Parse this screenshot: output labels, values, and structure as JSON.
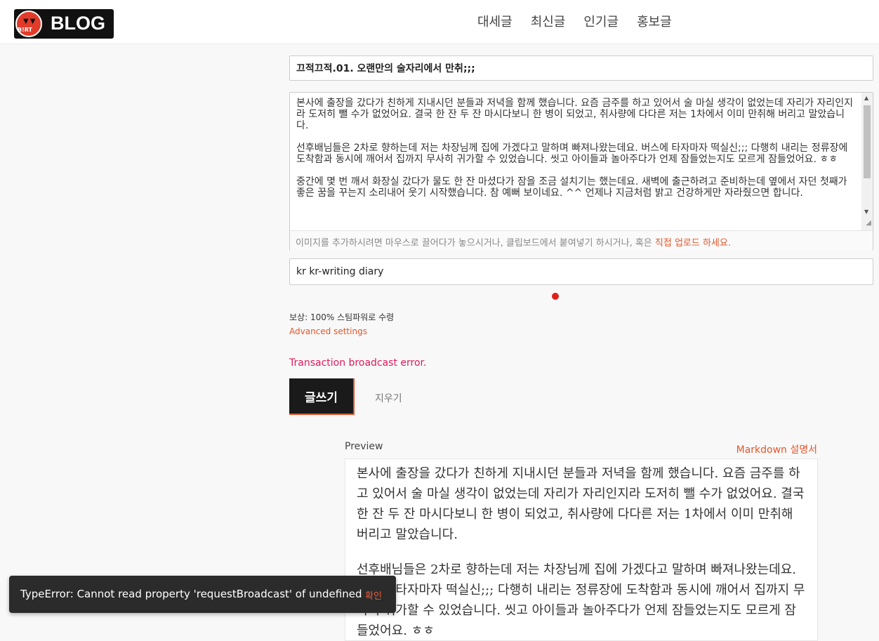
{
  "header": {
    "logo_text": "BLOG",
    "logo_badge_text": "B!RT",
    "nav": [
      "대세글",
      "최신글",
      "인기글",
      "홍보글"
    ]
  },
  "editor": {
    "title_value": "끄적끄적.01. 오랜만의 술자리에서 만취;;;",
    "body_paragraphs": [
      "본사에 출장을 갔다가 친하게 지내시던 분들과 저녁을 함께 했습니다. 요즘 금주를 하고 있어서 술 마실 생각이 없었는데 자리가 자리인지라 도저히 뺄 수가 없었어요. 결국 한 잔 두 잔 마시다보니 한 병이 되었고, 취사량에 다다른 저는 1차에서 이미 만취해 버리고 말았습니다.",
      "선후배님들은 2차로 향하는데 저는 차장님께 집에 가겠다고 말하며 빠져나왔는데요. 버스에 타자마자 떡실신;;; 다행히 내리는 정류장에 도착함과 동시에 깨어서 집까지 무사히 귀가할 수 있었습니다. 씻고 아이들과 놀아주다가 언제 잠들었는지도 모르게 잠들었어요. ㅎㅎ",
      "중간에 몇 번 깨서 화장실 갔다가 물도 한 잔 마셨다가 잠을 조금 설치기는 했는데요. 새벽에 출근하려고 준비하는데 옆에서 자던 첫째가 좋은 꿈을 꾸는지 소리내어 웃기 시작했습니다. 참 예뻐 보이네요. ^^ 언제나 지금처럼 밝고 건강하게만 자라줬으면 합니다."
    ],
    "upload_hint_prefix": "이미지를 추가하시려면 마우스로 끌어다가 놓으시거나, 클립보드에서 붙여넣기 하시거나, 혹은 ",
    "upload_hint_link": "직접 업로드 하세요",
    "upload_hint_suffix": ".",
    "tags_value": "kr kr-writing diary",
    "reward": "보상: 100% 스팀파워로 수령",
    "advanced_settings": "Advanced settings",
    "error": "Transaction broadcast error.",
    "post_label": "글쓰기",
    "clear_label": "지우기"
  },
  "preview": {
    "label": "Preview",
    "markdown_link": "Markdown 설명서",
    "paragraphs": [
      "본사에 출장을 갔다가 친하게 지내시던 분들과 저녁을 함께 했습니다. 요즘 금주를 하고 있어서 술 마실 생각이 없었는데 자리가 자리인지라 도저히 뺄 수가 없었어요. 결국 한 잔 두 잔 마시다보니 한 병이 되었고, 취사량에 다다른 저는 1차에서 이미 만취해 버리고 말았습니다.",
      "선후배님들은 2차로 향하는데 저는 차장님께 집에 가겠다고 말하며 빠져나왔는데요. 버스에 타자마자 떡실신;;; 다행히 내리는 정류장에 도착함과 동시에 깨어서 집까지 무사히 귀가할 수 있었습니다. 씻고 아이들과 놀아주다가 언제 잠들었는지도 모르게 잠들었어요. ㅎㅎ"
    ]
  },
  "toast": {
    "message": "TypeError: Cannot read property 'requestBroadcast' of undefined",
    "confirm": "확인"
  },
  "colors": {
    "accent": "#e4562a",
    "error": "#e0195a",
    "button_dark": "#1a1a1a",
    "dot": "#e0201c"
  }
}
